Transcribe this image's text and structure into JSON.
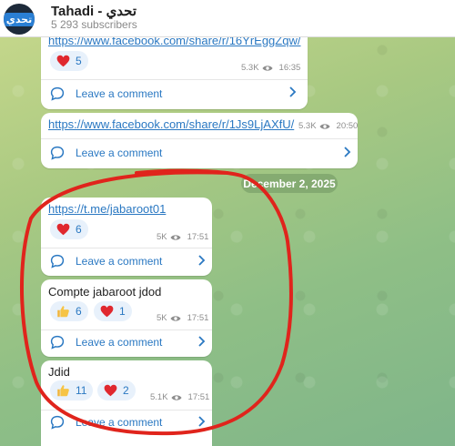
{
  "header": {
    "title": "Tahadi - تحدي",
    "subtitle": "5 293 subscribers",
    "avatar_text": "تحدي"
  },
  "date_separator": "December 2, 2025",
  "comment_label": "Leave a comment",
  "messages": [
    {
      "link": "https://www.facebook.com/share/r/16YrEggZqw/",
      "reactions": [
        {
          "icon": "heart",
          "count": "5"
        }
      ],
      "views": "5.3K",
      "time": "16:35"
    },
    {
      "link": "https://www.facebook.com/share/r/1Js9LjAXfU/",
      "reactions": [],
      "views": "5.3K",
      "time": "20:50"
    },
    {
      "link": "https://t.me/jabaroot01",
      "reactions": [
        {
          "icon": "heart",
          "count": "6"
        }
      ],
      "views": "5K",
      "time": "17:51"
    },
    {
      "text": "Compte jabaroot jdod",
      "reactions": [
        {
          "icon": "thumbs-up",
          "count": "6"
        },
        {
          "icon": "heart",
          "count": "1"
        }
      ],
      "views": "5K",
      "time": "17:51"
    },
    {
      "text": "Jdid",
      "reactions": [
        {
          "icon": "thumbs-up",
          "count": "11"
        },
        {
          "icon": "heart",
          "count": "2"
        }
      ],
      "views": "5.1K",
      "time": "17:51"
    }
  ],
  "colors": {
    "link": "#2a78c2",
    "heart": "#e0282e",
    "annotation": "#e0241c"
  }
}
